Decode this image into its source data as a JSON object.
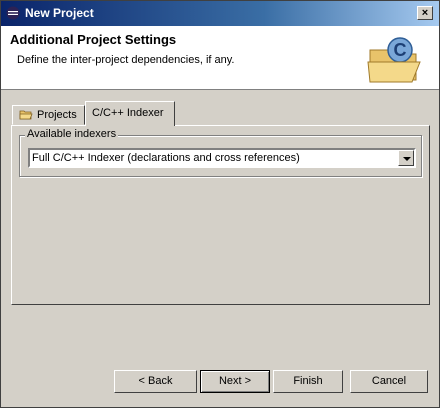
{
  "window": {
    "title": "New Project",
    "close_glyph": "×"
  },
  "header": {
    "title": "Additional Project Settings",
    "description": "Define the inter-project dependencies, if any.",
    "image_icon": "c-project-folder-icon"
  },
  "tabs": [
    {
      "label": "Projects",
      "icon": "folder-icon",
      "selected": false
    },
    {
      "label": "C/C++ Indexer",
      "selected": true
    }
  ],
  "indexer": {
    "group_label": "Available indexers",
    "selected_value": "Full C/C++ Indexer (declarations and cross references)"
  },
  "buttons": {
    "back": "< Back",
    "next": "Next >",
    "finish": "Finish",
    "cancel": "Cancel"
  }
}
